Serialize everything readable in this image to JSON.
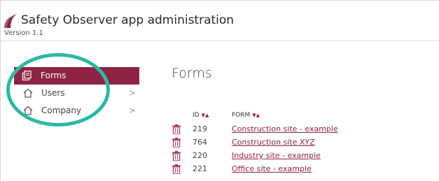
{
  "header": {
    "title": "Safety Observer app administration",
    "version": "Version 1.1"
  },
  "sidebar": {
    "items": [
      {
        "label": "Forms",
        "icon": "forms-icon",
        "active": true
      },
      {
        "label": "Users",
        "icon": "home-icon",
        "active": false,
        "chevron": ">"
      },
      {
        "label": "Company",
        "icon": "home-icon",
        "active": false,
        "chevron": ">"
      }
    ]
  },
  "main": {
    "title": "Forms",
    "table": {
      "columns": [
        {
          "label": "ID",
          "sort": "▼▲"
        },
        {
          "label": "FORM",
          "sort": "▼▲"
        }
      ],
      "rows": [
        {
          "id": "219",
          "form": "Construction site - example"
        },
        {
          "id": "764",
          "form": "Construction site XYZ"
        },
        {
          "id": "220",
          "form": "Industry site - example"
        },
        {
          "id": "221",
          "form": "Office site - example"
        }
      ]
    }
  },
  "colors": {
    "accent": "#8e2444",
    "highlight": "#2bb8a2"
  }
}
